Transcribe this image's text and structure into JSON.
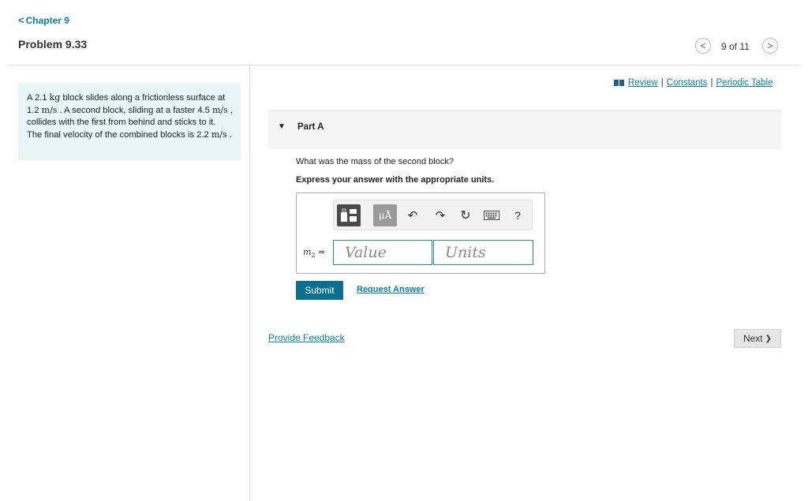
{
  "header": {
    "back_chevron": "<",
    "chapter_label": "Chapter 9",
    "problem_title": "Problem 9.33",
    "pager_text": "9 of 11",
    "prev_symbol": "<",
    "next_symbol": ">"
  },
  "problem": {
    "p1": "A 2.1 ",
    "u1": "kg",
    "p2": " block slides along a frictionless surface at 1.2 ",
    "u2": "m/s",
    "p3": " . A second block, sliding at a faster 4.5 ",
    "u3": "m/s",
    "p4": " , collides with the first from behind and sticks to it. The final velocity of the combined blocks is 2.2 ",
    "u4": "m/s",
    "p5": " ."
  },
  "resources": {
    "review": "Review",
    "sep": "|",
    "constants": "Constants",
    "periodic_table": "Periodic Table",
    "book_icon": "book-icon"
  },
  "part_a": {
    "caret": "▼",
    "title": "Part A",
    "question": "What was the mass of the second block?",
    "instruction": "Express your answer with the appropriate units."
  },
  "toolbar": {
    "symbols_label": "μÅ",
    "undo_glyph": "↶",
    "redo_glyph": "↷",
    "reset_glyph": "↻",
    "help_label": "?"
  },
  "answer": {
    "var_main": "m",
    "var_sub": "2",
    "var_eq": " =",
    "value_placeholder": "Value",
    "units_placeholder": "Units",
    "value": "",
    "units": ""
  },
  "actions": {
    "submit": "Submit",
    "request_answer": "Request Answer",
    "provide_feedback": "Provide Feedback",
    "next": "Next",
    "next_chevron": "❯"
  },
  "colors": {
    "accent": "#0a7fa8",
    "submit_bg": "#0b6f8e",
    "problem_bg": "#e8f5f7"
  }
}
